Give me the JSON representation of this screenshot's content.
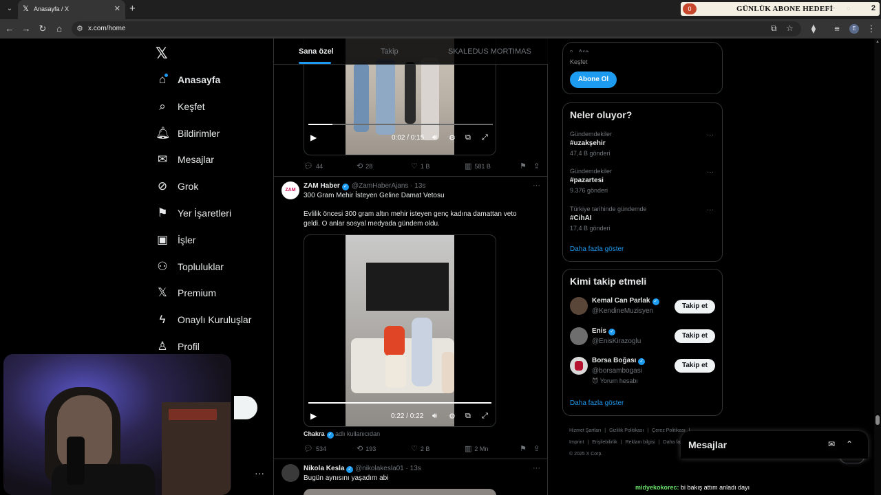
{
  "browser": {
    "tab_title": "Anasayfa / X",
    "url": "x.com/home"
  },
  "overlay_goal": {
    "count": "0",
    "title": "GÜNLÜK ABONE HEDEFİ",
    "target": "2"
  },
  "sidebar": {
    "items": [
      {
        "label": "Anasayfa",
        "icon": "home-icon"
      },
      {
        "label": "Keşfet",
        "icon": "search-icon"
      },
      {
        "label": "Bildirimler",
        "icon": "bell-icon"
      },
      {
        "label": "Mesajlar",
        "icon": "mail-icon"
      },
      {
        "label": "Grok",
        "icon": "grok-icon"
      },
      {
        "label": "Yer İşaretleri",
        "icon": "bookmark-icon"
      },
      {
        "label": "İşler",
        "icon": "briefcase-icon"
      },
      {
        "label": "Topluluklar",
        "icon": "people-icon"
      },
      {
        "label": "Premium",
        "icon": "x-icon"
      },
      {
        "label": "Onaylı Kuruluşlar",
        "icon": "lightning-icon"
      },
      {
        "label": "Profil",
        "icon": "person-icon"
      }
    ]
  },
  "timeline": {
    "tabs": [
      "Sana özel",
      "Takip",
      "SKALEDUS MORTIMAS"
    ],
    "posts": [
      {
        "video_time": "0:02 / 0:15",
        "video_progress": 0.13,
        "stats": {
          "replies": "44",
          "reposts": "28",
          "likes": "1 B",
          "views": "581 B"
        }
      },
      {
        "name": "ZAM Haber",
        "avatar_text": "ZAM",
        "handle": "@ZamHaberAjans · 13s",
        "title": "300 Gram Mehir İsteyen Geline Damat Vetosu",
        "body": "Evlilik öncesi 300 gram altın mehir isteyen genç kadına damattan veto geldi. O anlar sosyal medyada gündem oldu.",
        "video_time": "0:22 / 0:22",
        "video_progress": 1.0,
        "source_name": "Chakra",
        "source_note": "adlı kullanıcıdan",
        "stats": {
          "replies": "534",
          "reposts": "193",
          "likes": "2 B",
          "views": "2 Mn"
        }
      },
      {
        "name": "Nikola Kesla",
        "handle": "@nikolakesla01 · 13s",
        "text": "Bugün aynısını yaşadım abi"
      }
    ]
  },
  "right": {
    "search_placeholder": "Ara",
    "subscribe_cut": "Keşfet",
    "subscribe_button": "Abone Ol",
    "trends_title": "Neler oluyor?",
    "trends": [
      {
        "context": "Gündemdekiler",
        "tag": "#uzakşehir",
        "count": "47,4 B gönderi"
      },
      {
        "context": "Gündemdekiler",
        "tag": "#pazartesi",
        "count": "9.376 gönderi"
      },
      {
        "context": "Türkiye tarihinde gündemde",
        "tag": "#CihAI",
        "count": "17,4 B gönderi"
      }
    ],
    "trends_more": "Daha fazla göster",
    "follow_title": "Kimi takip etmeli",
    "follow": [
      {
        "name": "Kemal Can Parlak",
        "handle": "@KendineMuzisyen",
        "button": "Takip et",
        "color": "#5a4638"
      },
      {
        "name": "Enis",
        "handle": "@EnisKirazoglu",
        "button": "Takip et",
        "color": "#6e6e6e"
      },
      {
        "name": "Borsa Boğası",
        "handle": "@borsambogasi",
        "extra": "😈 Yorum hesabı",
        "button": "Takip et",
        "color": "#d9d9d9"
      }
    ],
    "follow_more": "Daha fazla göster",
    "footer": [
      "Hizmet Şartları",
      "|",
      "Gizlilik Politikası",
      "|",
      "Çerez Politikası",
      "|",
      "Imprint",
      "|",
      "Erişilebilirlik",
      "|",
      "Reklam bilgisi",
      "|",
      "Daha fazla ...",
      "© 2025 X Corp."
    ]
  },
  "messages_drawer": {
    "title": "Mesajlar"
  },
  "stream_chat": {
    "user": "midyekokorec:",
    "text": "bi bakış attım anladı dayı"
  }
}
